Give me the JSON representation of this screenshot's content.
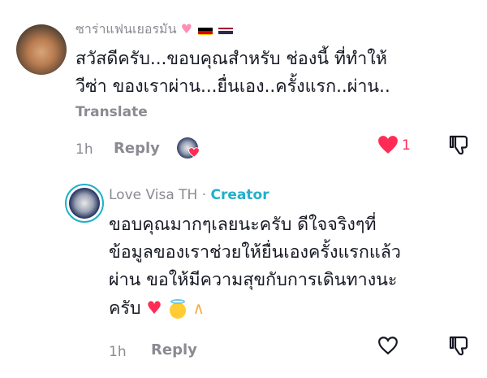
{
  "comment1": {
    "username": "ซาร่าแฟนเยอรมัน",
    "username_emojis": [
      "pink-heart",
      "germany-flag",
      "thailand-flag"
    ],
    "line1": "สวัสดีครับ...ขอบคุณสำหรับ ช่องนี้ ที่ทำให้",
    "line2": "วีซ่า ของเราผ่าน...ยื่นเอง..ครั้งแรก..ผ่าน..",
    "translate_label": "Translate",
    "time": "1h",
    "reply_label": "Reply",
    "like_count": "1",
    "liked": true
  },
  "comment2": {
    "username": "Love Visa TH",
    "separator": "·",
    "creator_label": "Creator",
    "line1": "ขอบคุณมากๆเลยนะครับ ดีใจจริงๆที่",
    "line2": "ข้อมูลของเราช่วยให้ยื่นเองครั้งแรกแล้ว",
    "line3": "ผ่าน ขอให้มีความสุขกับการเดินทางนะ",
    "line4": "ครับ",
    "emojis": [
      "red-heart",
      "smiling-face-with-halo",
      "folded-hands"
    ],
    "time": "1h",
    "reply_label": "Reply"
  },
  "colors": {
    "like_red": "#fe2c55",
    "creator_teal": "#20b0c9",
    "muted_gray": "#8a8b91",
    "text": "#161823"
  }
}
